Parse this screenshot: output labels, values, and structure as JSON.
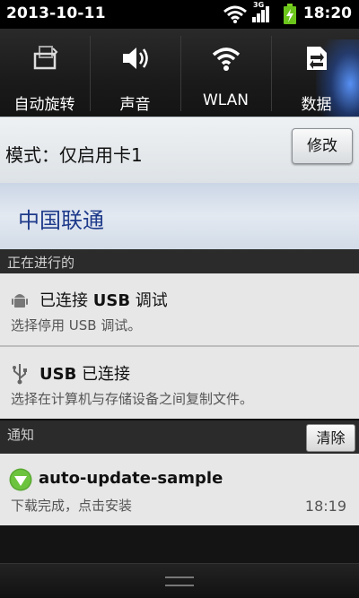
{
  "status_bar": {
    "date": "2013-10-11",
    "time": "18:20",
    "network_type": "3G",
    "icons": [
      "wifi-icon",
      "signal-icon",
      "battery-charging-icon"
    ]
  },
  "quick_toggles": [
    {
      "label": "自动旋转",
      "icon": "auto-rotate-icon"
    },
    {
      "label": "声音",
      "icon": "sound-icon"
    },
    {
      "label": "WLAN",
      "icon": "wlan-icon"
    },
    {
      "label": "数据",
      "icon": "data-icon"
    }
  ],
  "sim": {
    "mode_label": "模式：仅启用卡1",
    "modify_button": "修改",
    "carrier": "中国联通"
  },
  "ongoing": {
    "header": "正在进行的",
    "items": [
      {
        "title_prefix": "已连接 ",
        "title_bold": "USB",
        "title_suffix": " 调试",
        "text": "选择停用 USB 调试。",
        "icon": "android-debug-icon"
      },
      {
        "title_bold": "USB",
        "title_suffix": " 已连接",
        "text": "选择在计算机与存储设备之间复制文件。",
        "icon": "usb-icon"
      }
    ]
  },
  "notifications": {
    "header": "通知",
    "clear_button": "清除",
    "items": [
      {
        "title": "auto-update-sample",
        "text": "下载完成，点击安装",
        "time": "18:19",
        "icon": "download-complete-icon"
      }
    ]
  },
  "colors": {
    "carrier_text": "#1e3a8a",
    "download_icon": "#5aa833",
    "wlan_glow": "#5a96ff"
  }
}
